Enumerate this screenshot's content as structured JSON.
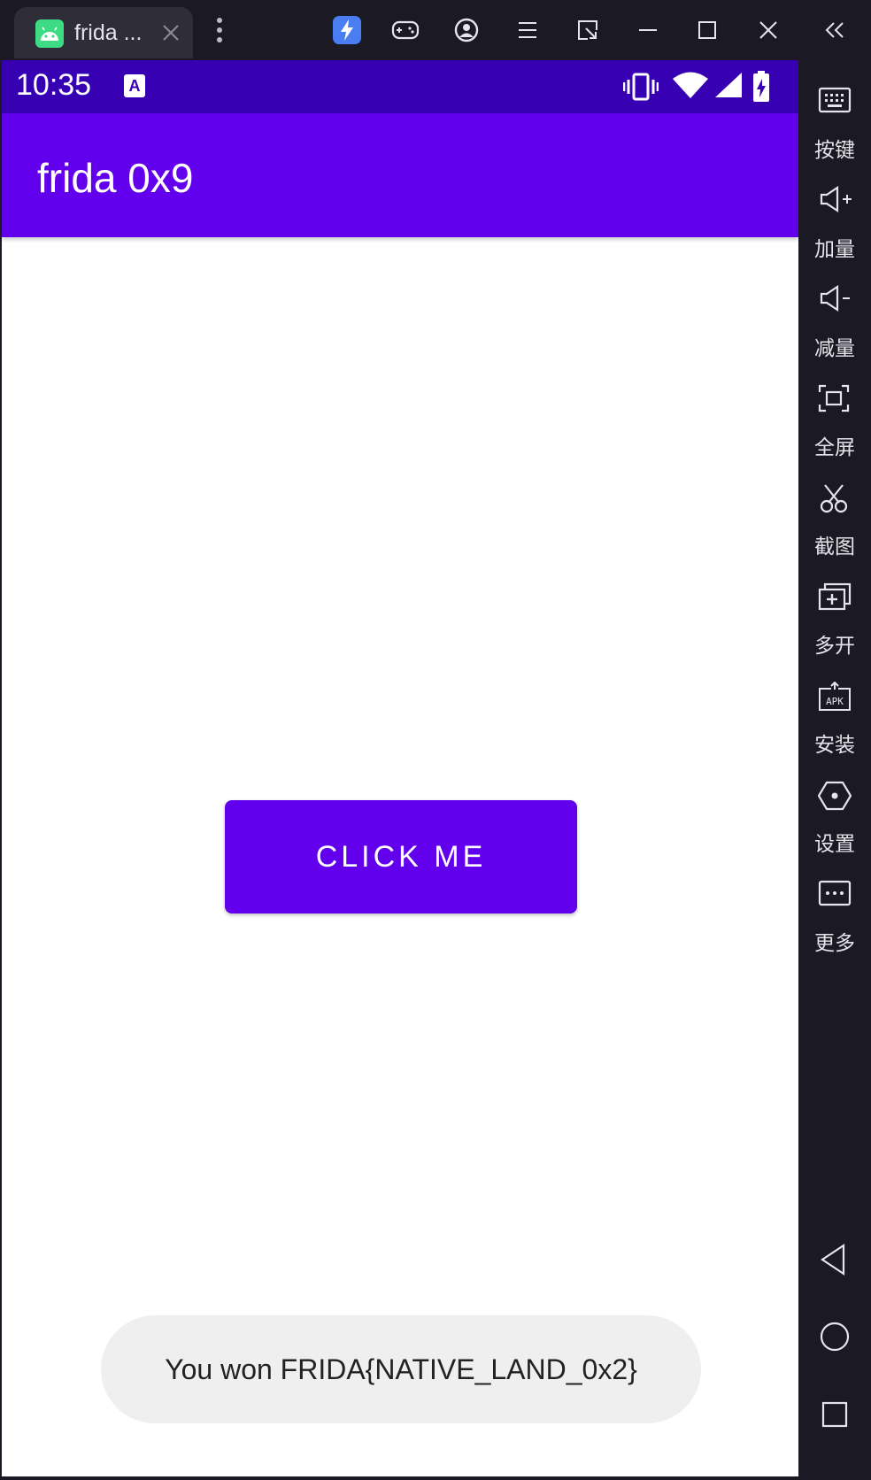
{
  "emulator": {
    "tab": {
      "title": "frida ...",
      "icon": "android-app-icon"
    },
    "toolbar_icons": [
      "more-vertical-icon",
      "lightning-app-icon",
      "gamepad-icon",
      "account-icon",
      "menu-icon",
      "window-resize-icon",
      "minimize-icon",
      "maximize-icon",
      "close-icon",
      "collapse-sidebar-icon"
    ],
    "sidebar": {
      "items": [
        {
          "label": "按键",
          "icon": "keyboard-icon"
        },
        {
          "label": "加量",
          "icon": "volume-up-icon"
        },
        {
          "label": "减量",
          "icon": "volume-down-icon"
        },
        {
          "label": "全屏",
          "icon": "fullscreen-icon"
        },
        {
          "label": "截图",
          "icon": "scissors-icon"
        },
        {
          "label": "多开",
          "icon": "multi-instance-icon"
        },
        {
          "label": "安装",
          "icon": "apk-install-icon"
        },
        {
          "label": "设置",
          "icon": "settings-hexagon-icon"
        },
        {
          "label": "更多",
          "icon": "more-icon"
        }
      ],
      "nav": [
        "back-triangle-icon",
        "home-circle-icon",
        "recents-square-icon"
      ]
    }
  },
  "phone": {
    "status_bar": {
      "time": "10:35",
      "notification_icon_letter": "A",
      "icons": [
        "vibrate-icon",
        "wifi-icon",
        "signal-icon",
        "battery-charging-icon"
      ]
    },
    "app_bar": {
      "title": "frida 0x9"
    },
    "main": {
      "button_label": "CLICK ME"
    },
    "toast": {
      "message": "You won FRIDA{NATIVE_LAND_0x2}"
    }
  },
  "colors": {
    "status_bar": "#3700b3",
    "app_bar": "#6200ee",
    "button": "#6200ee",
    "toast_bg": "#efefef",
    "emulator_chrome": "#1b1a24"
  }
}
